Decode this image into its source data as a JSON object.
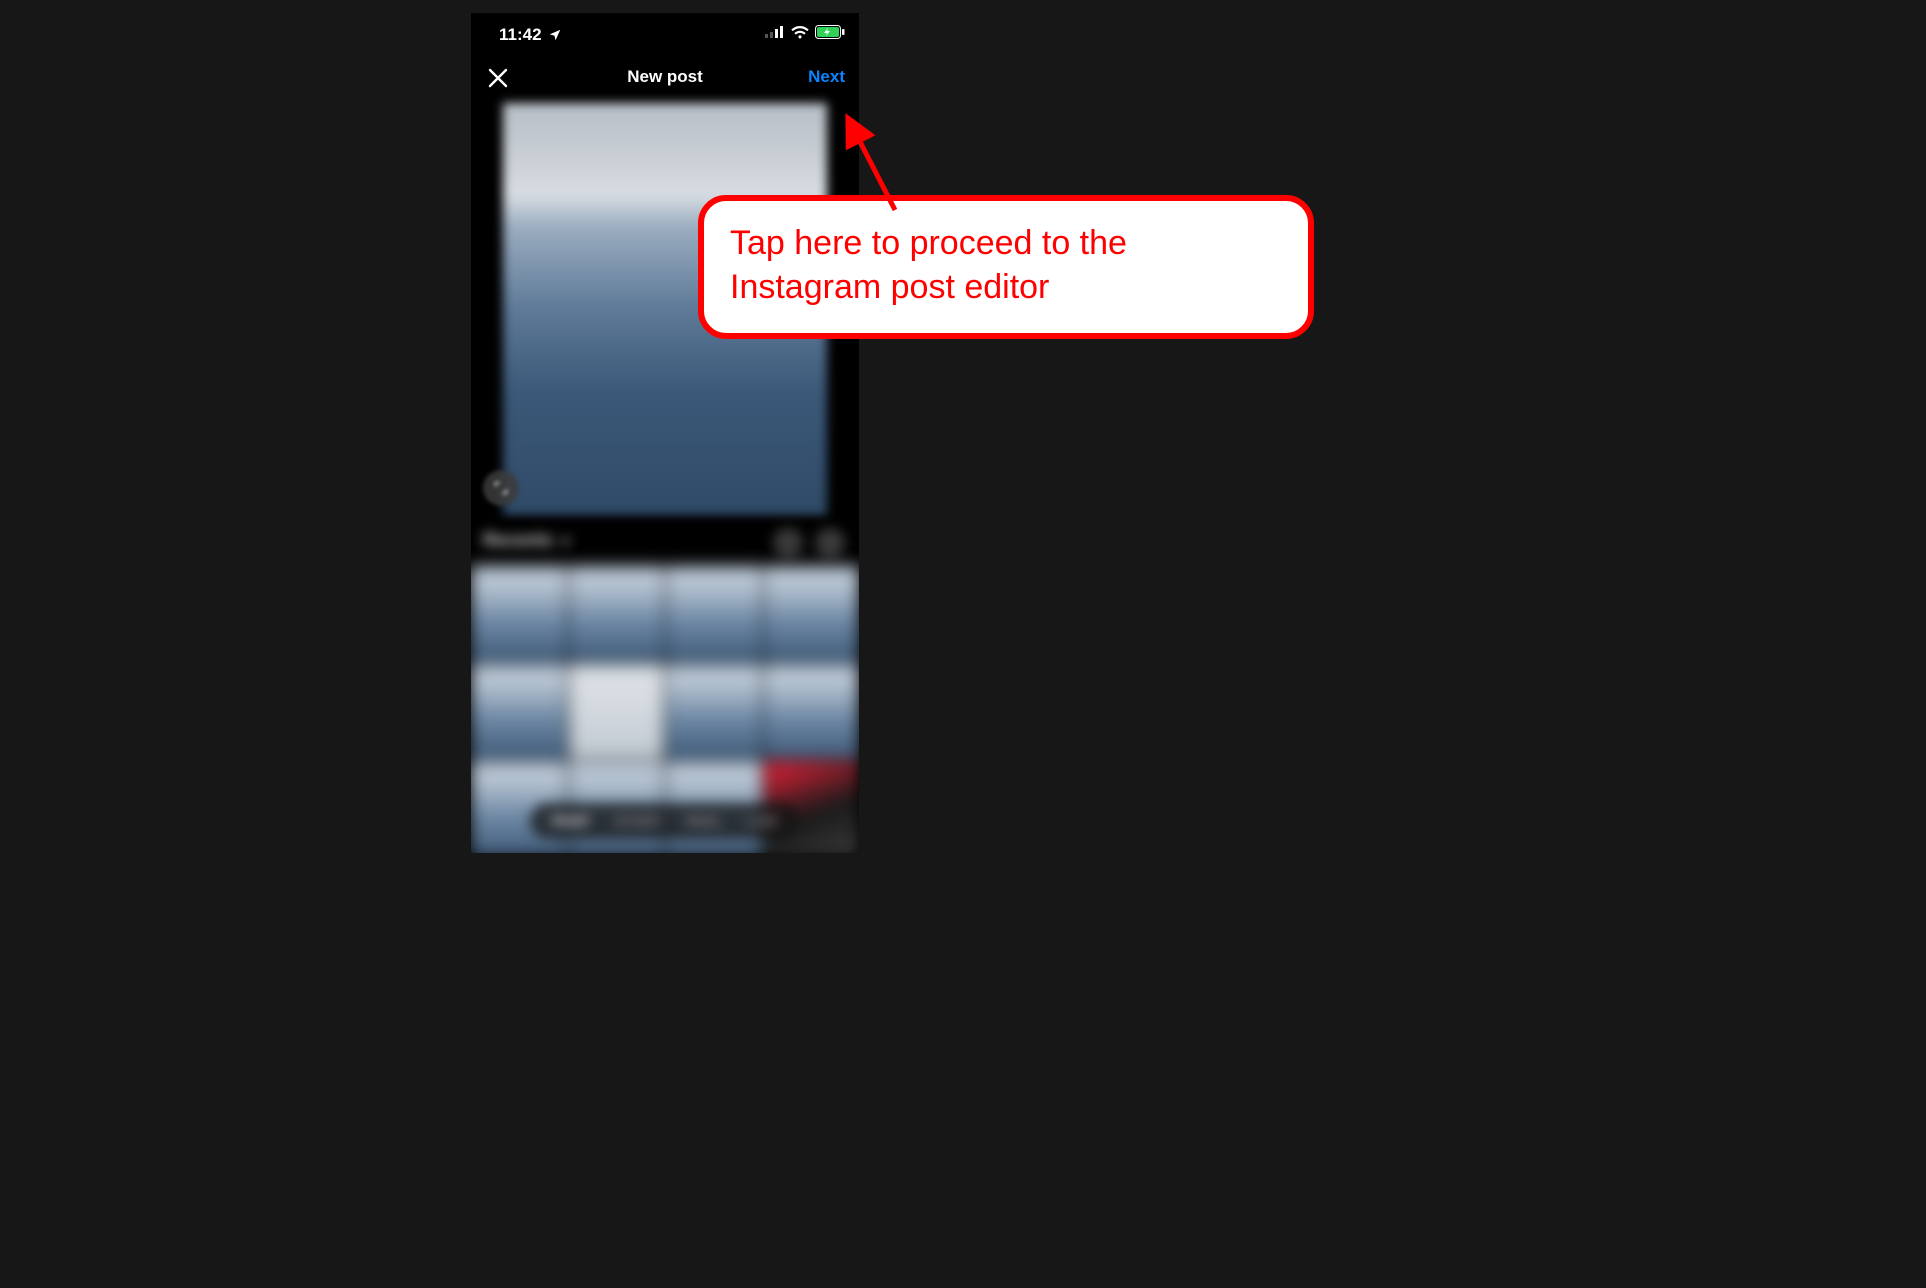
{
  "statusbar": {
    "time": "11:42"
  },
  "navbar": {
    "title": "New post",
    "next": "Next",
    "next_color": "#0a84ff"
  },
  "source": {
    "label": "Recents"
  },
  "tabs": {
    "items": [
      {
        "label": "POST",
        "active": true
      },
      {
        "label": "STORY",
        "active": false
      },
      {
        "label": "REEL",
        "active": false
      },
      {
        "label": "LIVE",
        "active": false
      }
    ]
  },
  "annotation": {
    "text": "Tap here to proceed to the Instagram post editor"
  }
}
